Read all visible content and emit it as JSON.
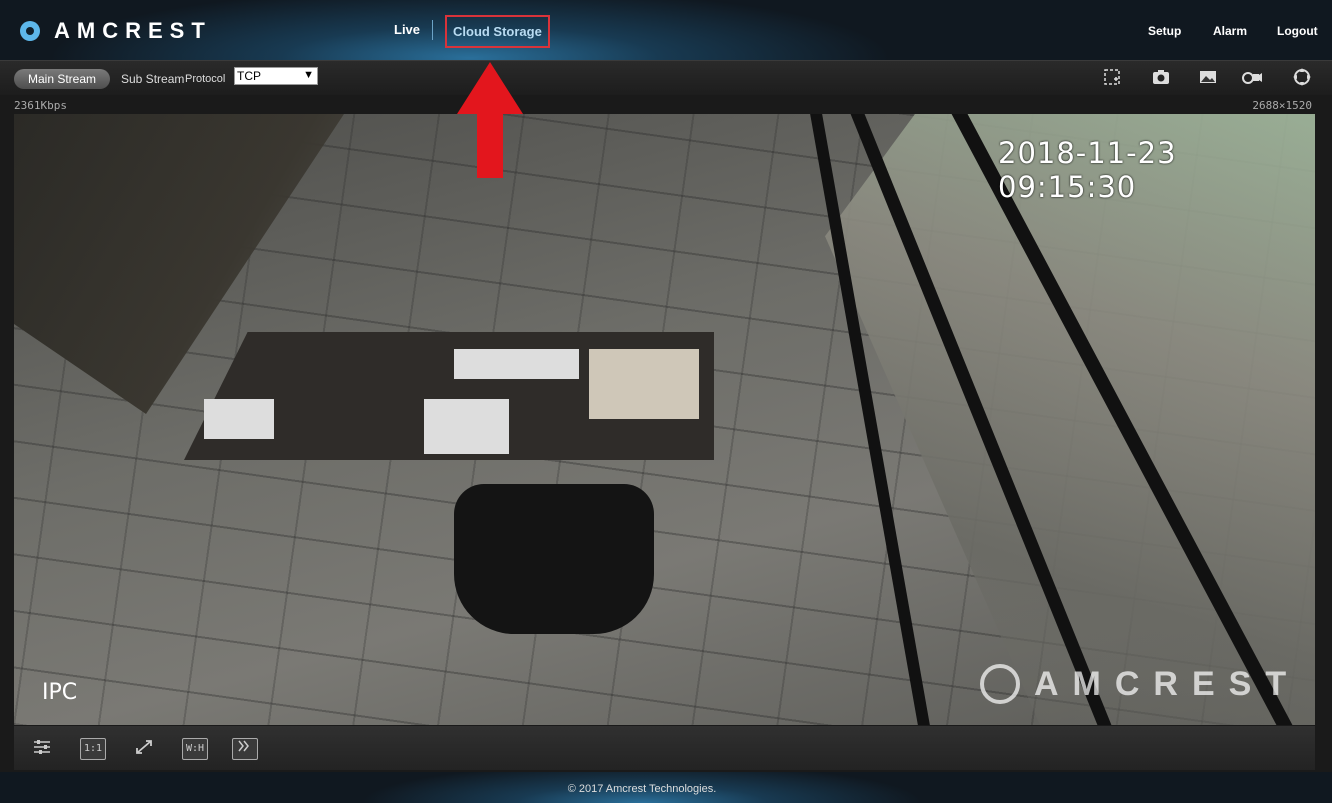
{
  "brand": {
    "name": "AMCREST",
    "accent": "#5db7ea"
  },
  "nav": {
    "live": "Live",
    "cloud_storage": "Cloud Storage",
    "setup": "Setup",
    "alarm": "Alarm",
    "logout": "Logout"
  },
  "toolbar": {
    "main_stream": "Main Stream",
    "sub_stream": "Sub Stream",
    "protocol_label": "Protocol",
    "protocol_value": "TCP",
    "icons": [
      "region-zoom-icon",
      "snapshot-camera-icon",
      "image-icon",
      "record-video-icon",
      "ptz-control-icon"
    ]
  },
  "status": {
    "bitrate": "2361Kbps",
    "resolution": "2688×1520"
  },
  "video": {
    "timestamp": "2018-11-23 09:15:30",
    "channel_label": "IPC",
    "watermark": "AMCREST"
  },
  "bottombar": {
    "icons": [
      "image-adjust-icon",
      "original-size-icon",
      "fullscreen-icon",
      "aspect-ratio-icon",
      "fluency-icon"
    ],
    "original_size_label": "1:1",
    "aspect_label": "W:H"
  },
  "footer": {
    "copyright": "© 2017 Amcrest Technologies."
  },
  "highlight_color": "#d9333a"
}
